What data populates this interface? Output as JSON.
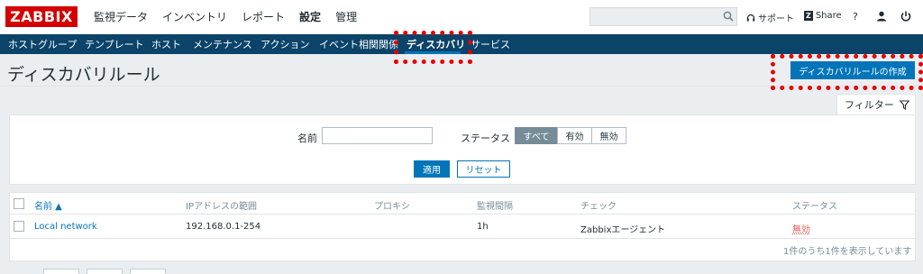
{
  "header": {
    "logo": "ZABBIX",
    "menu": [
      "監視データ",
      "インベントリ",
      "レポート",
      "設定",
      "管理"
    ],
    "active_menu": "設定",
    "search_placeholder": "",
    "support_label": "サポート",
    "share_badge": "Z",
    "share_label": "Share",
    "help_label": "?"
  },
  "subnav": {
    "items": [
      "ホストグループ",
      "テンプレート",
      "ホスト",
      "メンテナンス",
      "アクション",
      "イベント相関関係",
      "ディスカバリ",
      "サービス"
    ],
    "active": "ディスカバリ"
  },
  "page": {
    "title": "ディスカバリルール",
    "create_button": "ディスカバリルールの作成"
  },
  "filter": {
    "tab_label": "フィルター",
    "name_label": "名前",
    "name_value": "",
    "status_label": "ステータス",
    "status_options": [
      "すべて",
      "有効",
      "無効"
    ],
    "status_selected": "すべて",
    "apply_label": "適用",
    "reset_label": "リセット"
  },
  "table": {
    "columns": [
      "名前 ▲",
      "IPアドレスの範囲",
      "プロキシ",
      "監視間隔",
      "チェック",
      "ステータス"
    ],
    "rows": [
      {
        "name": "Local network",
        "ip_range": "192.168.0.1-254",
        "proxy": "",
        "interval": "1h",
        "checks": "Zabbixエージェント",
        "status": "無効"
      }
    ],
    "footer": "1件のうち1件を表示しています"
  },
  "colors": {
    "brand_red": "#d40000",
    "nav_blue": "#0b4369",
    "accent_blue": "#0275b8",
    "disabled_red": "#e45959",
    "highlight_red": "#e60000"
  }
}
